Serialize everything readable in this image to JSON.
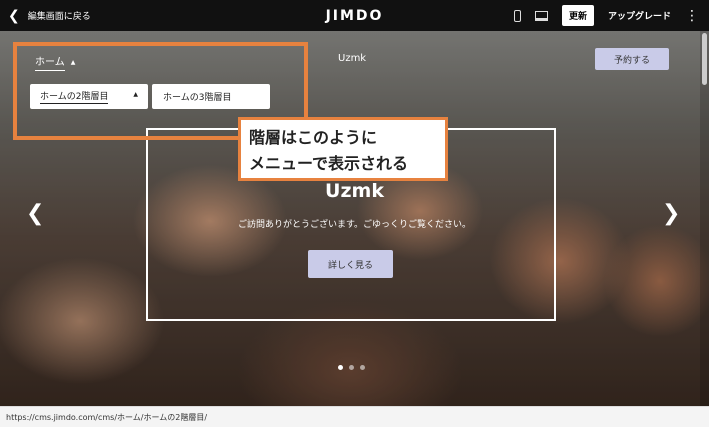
{
  "topbar": {
    "back_label": "編集画面に戻る",
    "logo": "JIMDO",
    "update_label": "更新",
    "upgrade_label": "アップグレード"
  },
  "site": {
    "name": "Uzmk",
    "nav": {
      "home": "ホーム",
      "sub_level2": "ホームの2階層目",
      "sub_level3": "ホームの3階層目"
    },
    "reserve_label": "予約する",
    "hero": {
      "title": "Uzmk",
      "subtitle": "ご訪問ありがとうございます。ごゆっくりご覧ください。",
      "more_label": "詳しく見る"
    },
    "slides_total": 3,
    "slide_active": 1
  },
  "annotation": {
    "line1": "階層はこのように",
    "line2": "メニューで表示される",
    "color": "#e7823f"
  },
  "status": {
    "url": "https://cms.jimdo.com/cms/ホーム/ホームの2階層目/"
  }
}
